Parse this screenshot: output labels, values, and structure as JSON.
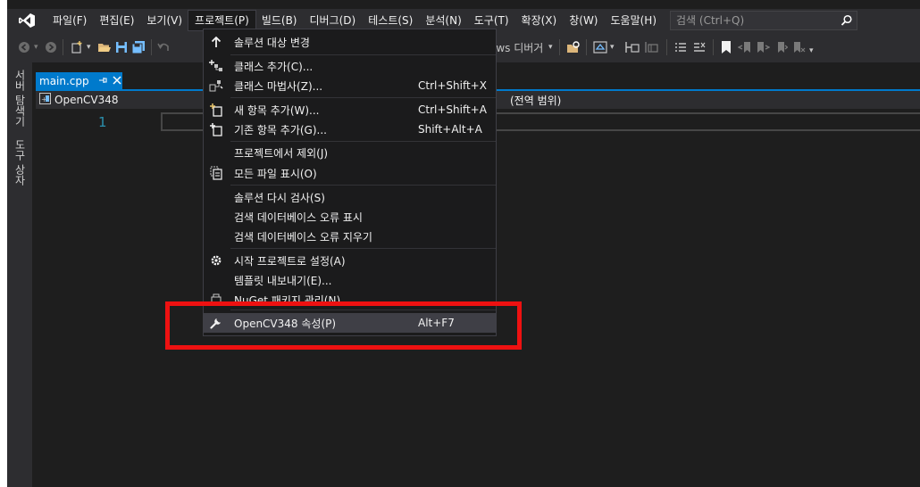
{
  "menubar": {
    "items": [
      "파일(F)",
      "편집(E)",
      "보기(V)",
      "프로젝트(P)",
      "빌드(B)",
      "디버그(D)",
      "테스트(S)",
      "분석(N)",
      "도구(T)",
      "확장(X)",
      "창(W)",
      "도움말(H)"
    ],
    "search_placeholder": "검색 (Ctrl+Q)"
  },
  "toolbar": {
    "debugger_label": "ows 디버거"
  },
  "sidebar": {
    "tabs": [
      "서버 탐색기",
      "도구 상자"
    ]
  },
  "document_tab": {
    "label": "main.cpp"
  },
  "navbar": {
    "project": "OpenCV348",
    "scope": "(전역 범위)"
  },
  "editor": {
    "line_number": "1"
  },
  "dropdown": {
    "items": [
      {
        "label": "솔루션 대상 변경",
        "shortcut": "",
        "icon": "arrow-up-icon"
      },
      {
        "label": "클래스 추가(C)...",
        "shortcut": "",
        "icon": "add-class-icon"
      },
      {
        "label": "클래스 마법사(Z)...",
        "shortcut": "Ctrl+Shift+X",
        "icon": "class-wizard-icon"
      },
      {
        "label": "새 항목 추가(W)...",
        "shortcut": "Ctrl+Shift+A",
        "icon": "new-item-icon"
      },
      {
        "label": "기존 항목 추가(G)...",
        "shortcut": "Shift+Alt+A",
        "icon": "existing-item-icon"
      },
      {
        "label": "프로젝트에서 제외(J)",
        "shortcut": "",
        "icon": ""
      },
      {
        "label": "모든 파일 표시(O)",
        "shortcut": "",
        "icon": "show-all-files-icon"
      },
      {
        "label": "솔루션 다시 검사(S)",
        "shortcut": "",
        "icon": ""
      },
      {
        "label": "검색 데이터베이스 오류 표시",
        "shortcut": "",
        "icon": ""
      },
      {
        "label": "검색 데이터베이스 오류 지우기",
        "shortcut": "",
        "icon": ""
      },
      {
        "label": "시작 프로젝트로 설정(A)",
        "shortcut": "",
        "icon": "gear-icon"
      },
      {
        "label": "템플릿 내보내기(E)...",
        "shortcut": "",
        "icon": ""
      },
      {
        "label": "NuGet 패키지 관리(N)...",
        "shortcut": "",
        "icon": "nuget-icon"
      },
      {
        "label": "OpenCV348 속성(P)",
        "shortcut": "Alt+F7",
        "icon": "wrench-icon"
      }
    ]
  },
  "colors": {
    "accent": "#007acc",
    "highlight_box": "#ee1111"
  }
}
